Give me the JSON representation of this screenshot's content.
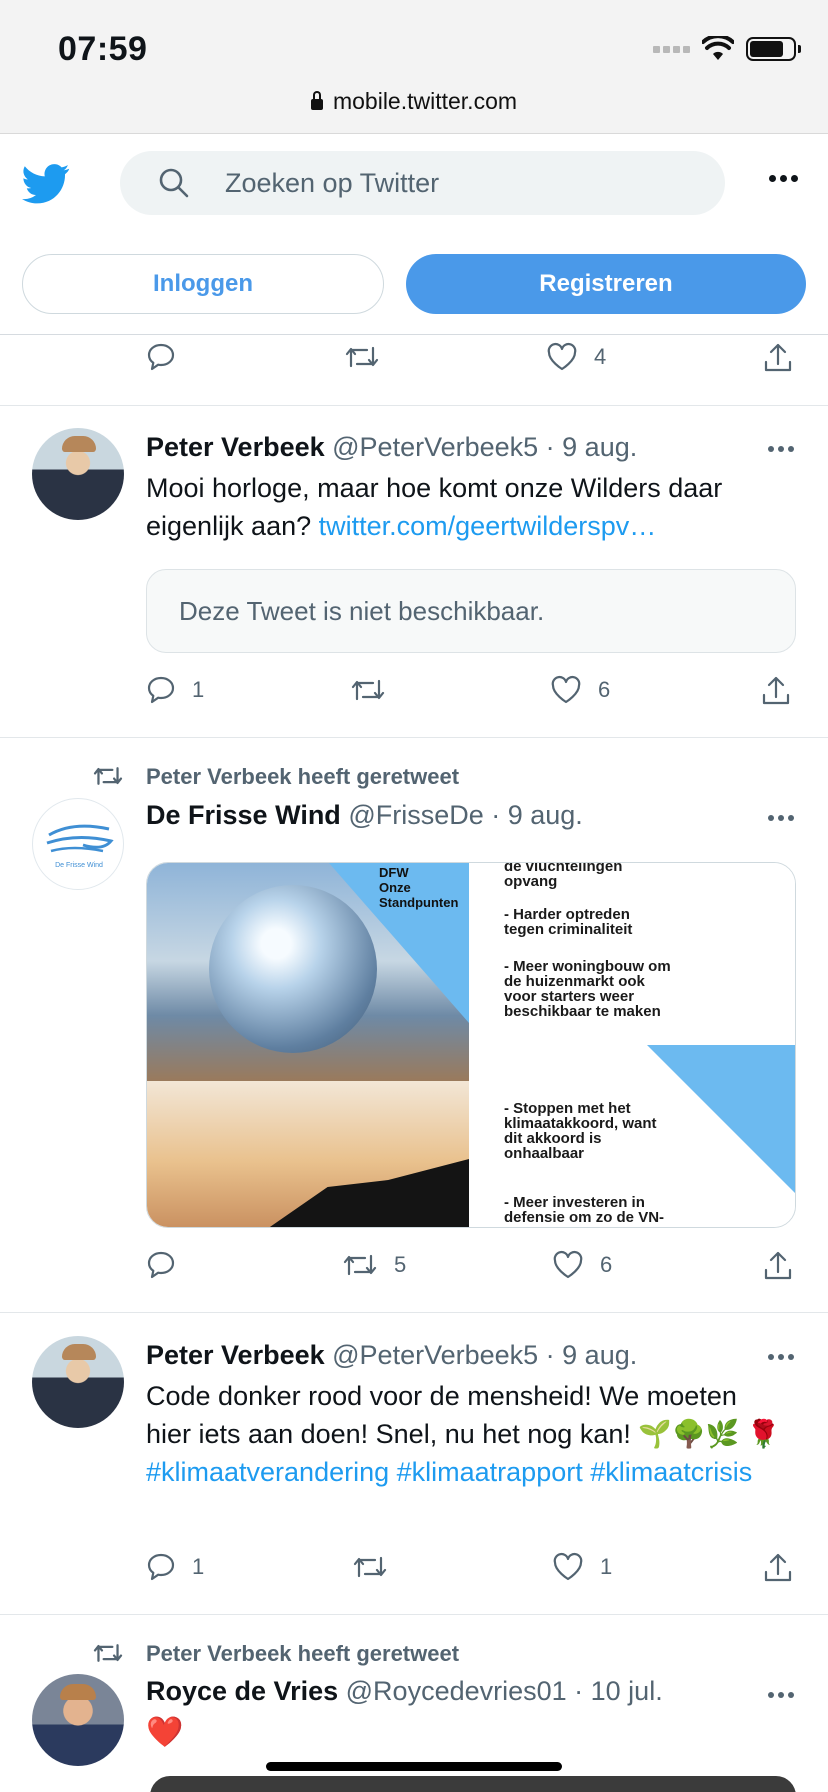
{
  "status_bar": {
    "time": "07:59"
  },
  "browser": {
    "url": "mobile.twitter.com"
  },
  "header": {
    "search_placeholder": "Zoeken op Twitter",
    "login_label": "Inloggen",
    "register_label": "Registreren"
  },
  "top_actions": {
    "like_count": "4"
  },
  "tweets": [
    {
      "name": "Peter Verbeek",
      "meta": "@PeterVerbeek5 · 9 aug.",
      "text": "Mooi horloge, maar hoe komt onze Wilders daar eigenlijk aan?",
      "link": "twitter.com/geertwilderspv…",
      "quote": "Deze Tweet is niet beschikbaar.",
      "reply_count": "1",
      "retweet_count": "",
      "like_count": "6"
    },
    {
      "retweet_label": "Peter Verbeek heeft geretweet",
      "name": "De Frisse Wind",
      "meta": "@FrisseDe · 9 aug.",
      "media": {
        "tag": "DFW\nOnze\nStandpunten",
        "lines": [
          "de vluchtelingen\nopvang",
          "- Harder optreden\ntegen criminaliteit",
          "- Meer woningbouw om\nde huizenmarkt ook\nvoor starters weer\nbeschikbaar te maken",
          "- Stoppen met het\nklimaatakkoord, want\ndit akkoord is\nonhaalbaar",
          "- Meer investeren in\ndefensie om zo de VN-"
        ]
      },
      "reply_count": "",
      "retweet_count": "5",
      "like_count": "6"
    },
    {
      "name": "Peter Verbeek",
      "meta": "@PeterVerbeek5 · 9 aug.",
      "text": "Code donker rood voor de mensheid! We moeten hier iets aan doen! Snel, nu het nog kan!",
      "emojis": "🌱🌳🌿",
      "rose": "🌹",
      "hashtags": "#klimaatverandering #klimaatrapport",
      "hashtag2": "#klimaatcrisis",
      "reply_count": "1",
      "retweet_count": "",
      "like_count": "1"
    },
    {
      "retweet_label": "Peter Verbeek heeft geretweet",
      "name": "Royce de Vries",
      "meta": "@Roycedevries01 · 10 jul.",
      "emoji": "❤️"
    }
  ],
  "colors": {
    "twitter_blue": "#1d9bf0",
    "button_blue": "#4a99e9",
    "secondary_text": "#536471"
  }
}
